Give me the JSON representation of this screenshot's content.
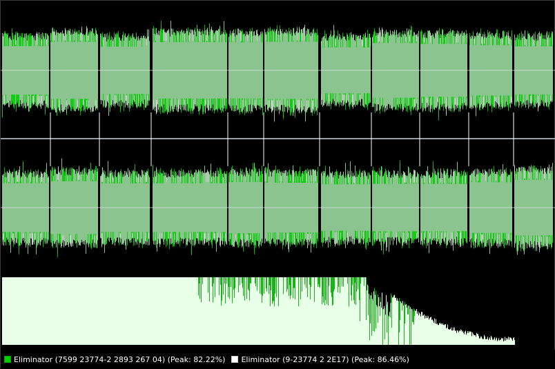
{
  "window": {
    "background": "#000000"
  },
  "colors": {
    "waveform_fill": "#8bc48f",
    "waveform_peak_a": "#00cc00",
    "waveform_peak_b": "#d8d8d8",
    "center_line": "#e0e0e0",
    "divider": "#9aa0a8",
    "marker": "#ffffff",
    "histogram_a": "#00aa00",
    "histogram_b": "#e8ffe8"
  },
  "legend": {
    "item_a": {
      "label": "Eliminator (7599 23774-2 2893 267 04) (Peak: 82.22%)",
      "color": "#00cc00",
      "icon": "green-square-swatch"
    },
    "item_b": {
      "label": "Eliminator (9-23774 2 2E17) (Peak: 86.46%)",
      "color": "#ffffff",
      "icon": "white-square-swatch"
    }
  }
}
